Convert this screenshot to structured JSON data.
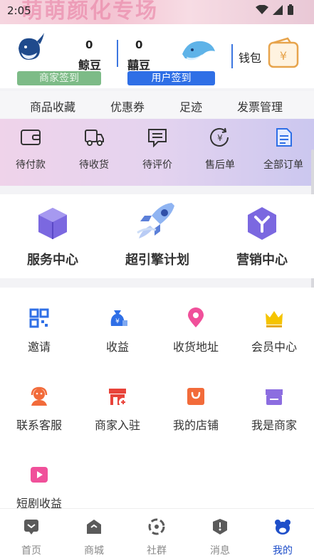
{
  "status": {
    "time": "2:05"
  },
  "banner": {
    "text": "萌萌颜化专场"
  },
  "header": {
    "merchant": {
      "count": "0",
      "unit": "鲸豆",
      "button": "商家签到"
    },
    "user": {
      "count": "0",
      "unit": "囍豆",
      "button": "用户签到"
    },
    "wallet_label": "钱包"
  },
  "quick_links": [
    "商品收藏",
    "优惠券",
    "足迹",
    "发票管理"
  ],
  "orders": [
    {
      "label": "待付款",
      "icon": "wallet-icon"
    },
    {
      "label": "待收货",
      "icon": "truck-icon"
    },
    {
      "label": "待评价",
      "icon": "comment-icon"
    },
    {
      "label": "售后单",
      "icon": "refund-icon"
    },
    {
      "label": "全部订单",
      "icon": "document-icon"
    }
  ],
  "services": [
    {
      "label": "服务中心",
      "icon": "cube-icon"
    },
    {
      "label": "超引擎计划",
      "icon": "rocket-icon"
    },
    {
      "label": "营销中心",
      "icon": "hex-y-icon"
    }
  ],
  "grid": [
    {
      "label": "邀请",
      "icon": "qr-code-icon"
    },
    {
      "label": "收益",
      "icon": "money-bag-icon"
    },
    {
      "label": "收货地址",
      "icon": "location-pin-icon"
    },
    {
      "label": "会员中心",
      "icon": "crown-icon"
    },
    {
      "label": "联系客服",
      "icon": "headset-icon"
    },
    {
      "label": "商家入驻",
      "icon": "store-add-icon"
    },
    {
      "label": "我的店铺",
      "icon": "shopping-bag-icon"
    },
    {
      "label": "我是商家",
      "icon": "merchant-icon"
    },
    {
      "label": "短剧收益",
      "icon": "video-play-icon"
    }
  ],
  "tabs": [
    {
      "label": "首页",
      "icon": "home-icon"
    },
    {
      "label": "商城",
      "icon": "shop-icon"
    },
    {
      "label": "社群",
      "icon": "community-icon"
    },
    {
      "label": "消息",
      "icon": "message-icon"
    },
    {
      "label": "我的",
      "icon": "bear-icon",
      "active": true
    }
  ],
  "colors": {
    "accent": "#2f6fe6",
    "merchant_green": "#7dbb87",
    "service_purple": "#7b68e0",
    "active_tab": "#1f4fc9"
  }
}
